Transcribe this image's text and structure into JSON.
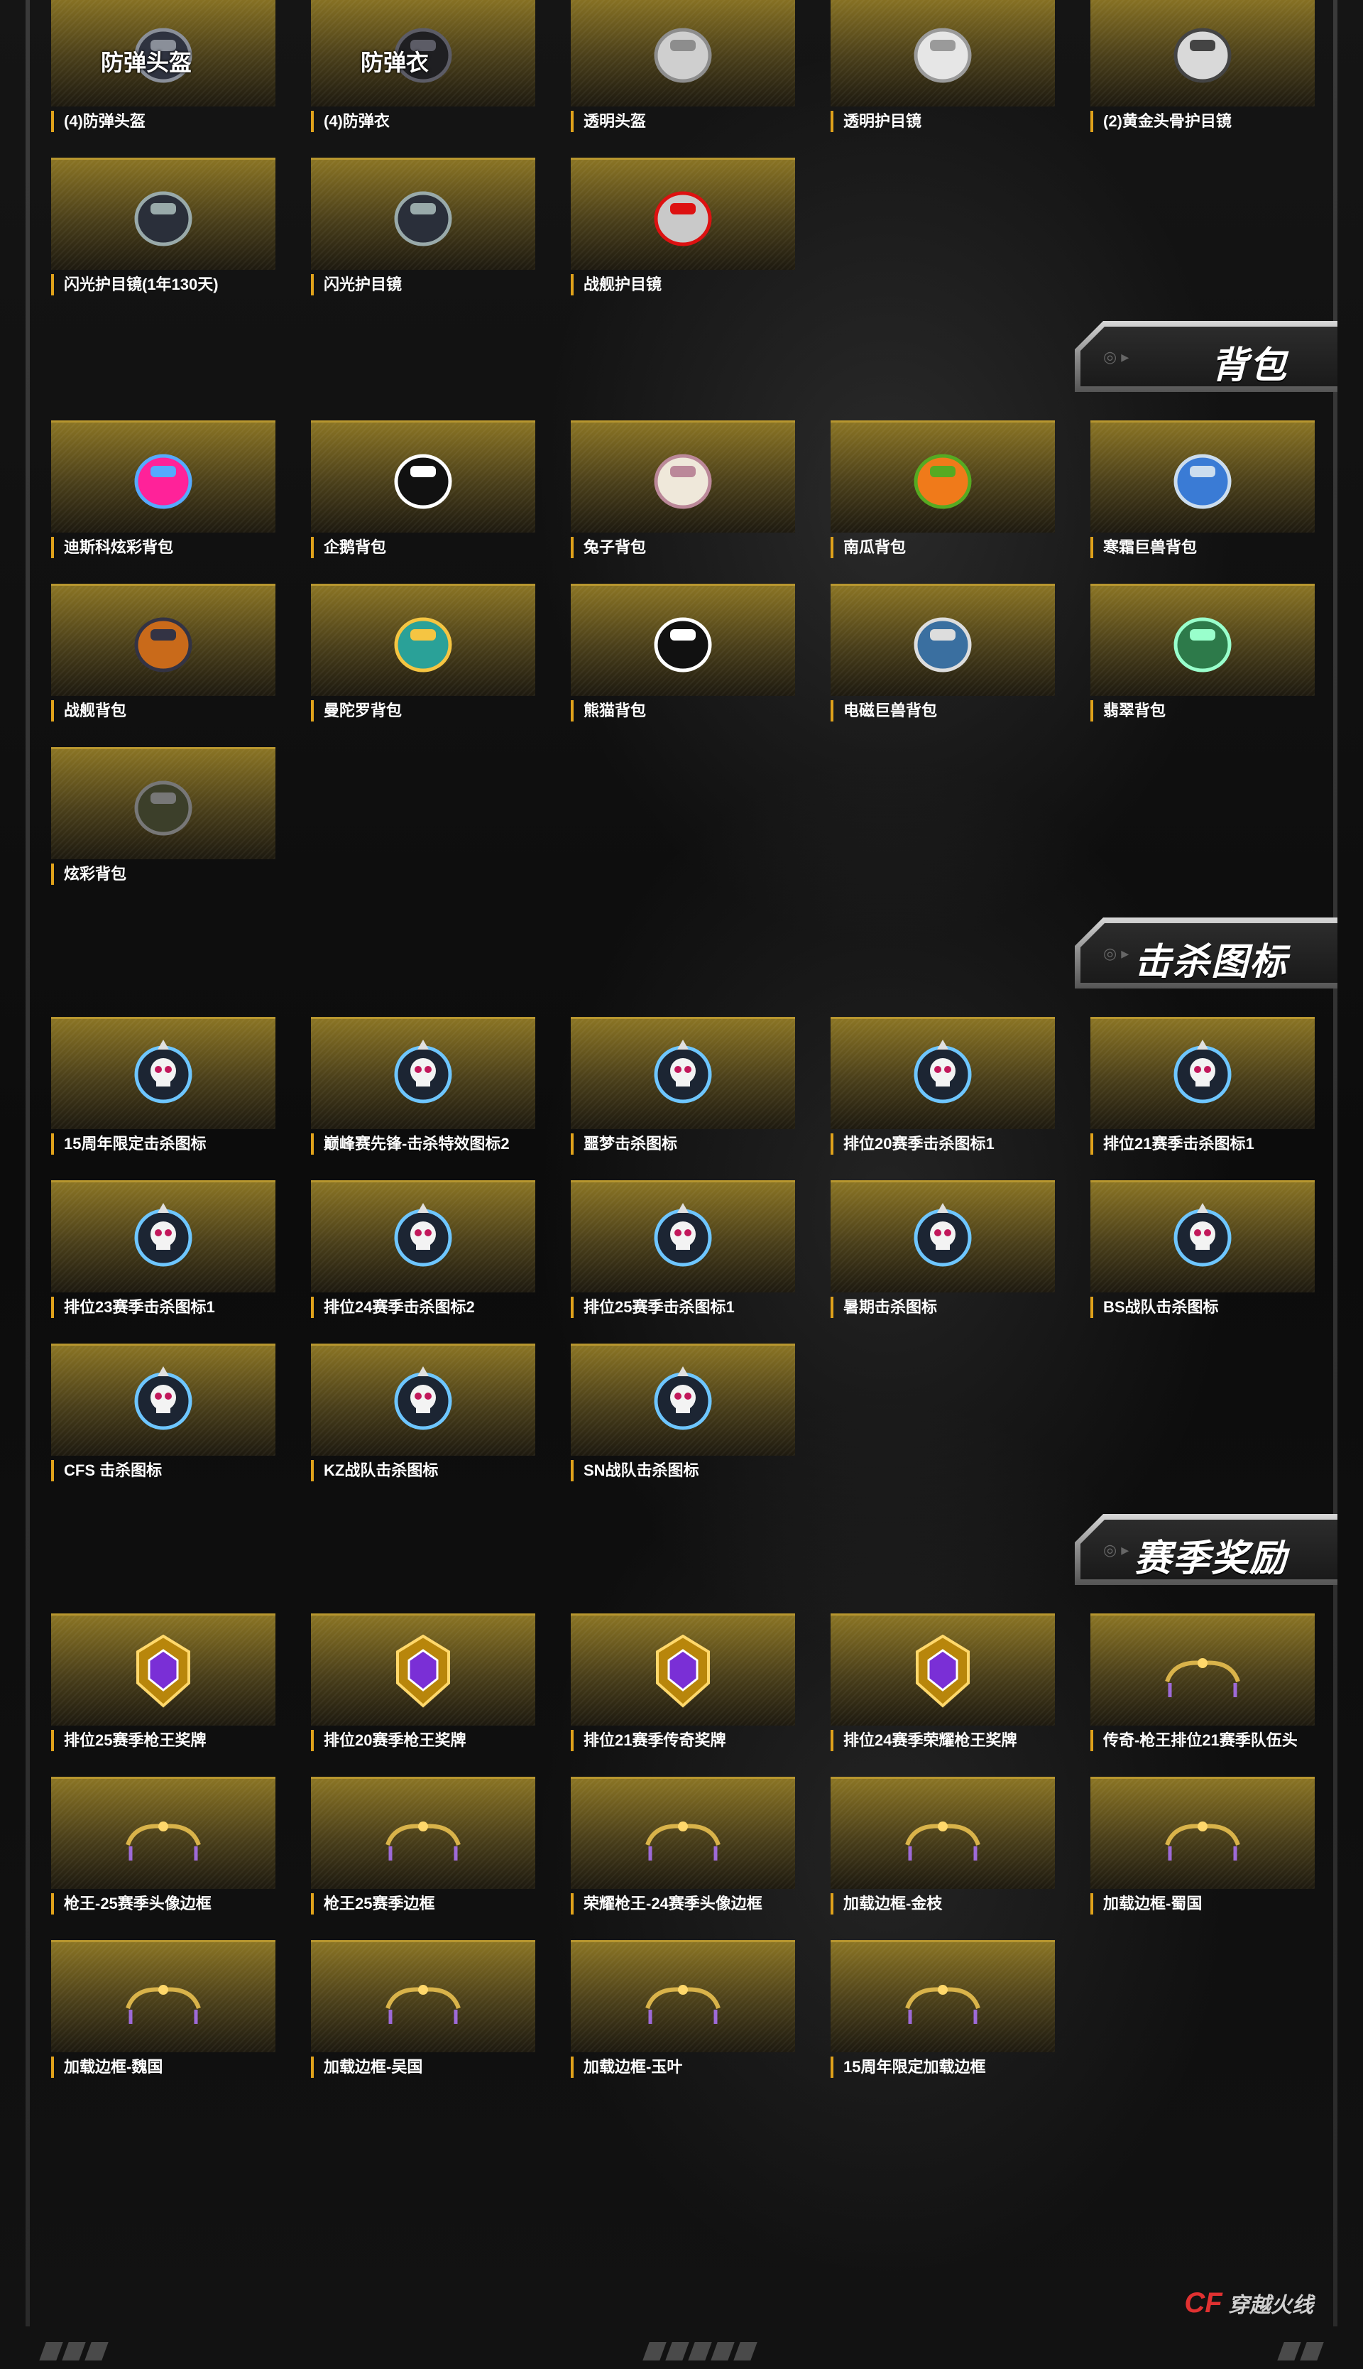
{
  "sections": [
    {
      "id": "gear",
      "title": "",
      "items": [
        {
          "label": "(4)防弹头盔",
          "icon": "helmet-icon",
          "caption": "防弹头盔"
        },
        {
          "label": "(4)防弹衣",
          "icon": "vest-icon",
          "caption": "防弹衣"
        },
        {
          "label": "透明头盔",
          "icon": "clear-helmet-icon",
          "caption": ""
        },
        {
          "label": "透明护目镜",
          "icon": "goggles-icon",
          "caption": ""
        },
        {
          "label": "(2)黄金头骨护目镜",
          "icon": "skull-goggles-icon",
          "caption": ""
        },
        {
          "label": "闪光护目镜(1年130天)",
          "icon": "sunglasses-icon",
          "caption": ""
        },
        {
          "label": "闪光护目镜",
          "icon": "sunglasses-icon",
          "caption": ""
        },
        {
          "label": "战舰护目镜",
          "icon": "battleship-goggles-icon",
          "caption": ""
        }
      ]
    },
    {
      "id": "backpack",
      "title": "背包",
      "items": [
        {
          "label": "迪斯科炫彩背包",
          "icon": "disco-backpack-icon"
        },
        {
          "label": "企鹅背包",
          "icon": "penguin-backpack-icon"
        },
        {
          "label": "兔子背包",
          "icon": "rabbit-backpack-icon"
        },
        {
          "label": "南瓜背包",
          "icon": "pumpkin-backpack-icon"
        },
        {
          "label": "寒霜巨兽背包",
          "icon": "frost-beast-backpack-icon"
        },
        {
          "label": "战舰背包",
          "icon": "battleship-backpack-icon"
        },
        {
          "label": "曼陀罗背包",
          "icon": "mandala-backpack-icon"
        },
        {
          "label": "熊猫背包",
          "icon": "panda-backpack-icon"
        },
        {
          "label": "电磁巨兽背包",
          "icon": "em-beast-backpack-icon"
        },
        {
          "label": "翡翠背包",
          "icon": "jade-backpack-icon"
        },
        {
          "label": "炫彩背包",
          "icon": "colorful-backpack-icon"
        }
      ]
    },
    {
      "id": "kill-icon",
      "title": "击杀图标",
      "items": [
        {
          "label": "15周年限定击杀图标",
          "icon": "anniversary-kill-icon"
        },
        {
          "label": "巅峰赛先锋-击杀特效图标2",
          "icon": "peak-vanguard-kill-icon"
        },
        {
          "label": "噩梦击杀图标",
          "icon": "nightmare-kill-icon"
        },
        {
          "label": "排位20赛季击杀图标1",
          "icon": "ranked-s20-kill-icon"
        },
        {
          "label": "排位21赛季击杀图标1",
          "icon": "ranked-s21-kill-icon"
        },
        {
          "label": "排位23赛季击杀图标1",
          "icon": "ranked-s23-kill-icon"
        },
        {
          "label": "排位24赛季击杀图标2",
          "icon": "ranked-s24-kill-icon"
        },
        {
          "label": "排位25赛季击杀图标1",
          "icon": "ranked-s25-kill-icon"
        },
        {
          "label": "暑期击杀图标",
          "icon": "summer-kill-icon"
        },
        {
          "label": "BS战队击杀图标",
          "icon": "bs-team-kill-icon"
        },
        {
          "label": "CFS 击杀图标",
          "icon": "cfs-kill-icon"
        },
        {
          "label": "KZ战队击杀图标",
          "icon": "kz-team-kill-icon"
        },
        {
          "label": "SN战队击杀图标",
          "icon": "sn-team-kill-icon"
        }
      ]
    },
    {
      "id": "season-rewards",
      "title": "赛季奖励",
      "items": [
        {
          "label": "排位25赛季枪王奖牌",
          "icon": "s25-medal-icon"
        },
        {
          "label": "排位20赛季枪王奖牌",
          "icon": "s20-medal-icon"
        },
        {
          "label": "排位21赛季传奇奖牌",
          "icon": "s21-legend-medal-icon"
        },
        {
          "label": "排位24赛季荣耀枪王奖牌",
          "icon": "s24-glory-medal-icon"
        },
        {
          "label": "传奇-枪王排位21赛季队伍头",
          "icon": "legend-team-frame-icon"
        },
        {
          "label": "枪王-25赛季头像边框",
          "icon": "s25-avatar-frame-icon"
        },
        {
          "label": "枪王25赛季边框",
          "icon": "s25-frame-icon"
        },
        {
          "label": "荣耀枪王-24赛季头像边框",
          "icon": "s24-avatar-frame-icon"
        },
        {
          "label": "加载边框-金枝",
          "icon": "golden-branch-frame-icon"
        },
        {
          "label": "加载边框-蜀国",
          "icon": "shu-frame-icon"
        },
        {
          "label": "加载边框-魏国",
          "icon": "wei-frame-icon"
        },
        {
          "label": "加载边框-吴国",
          "icon": "wu-frame-icon"
        },
        {
          "label": "加载边框-玉叶",
          "icon": "jade-leaf-frame-icon"
        },
        {
          "label": "15周年限定加载边框",
          "icon": "anniversary-frame-icon"
        }
      ]
    }
  ],
  "footer": {
    "logo_mark": "CF",
    "logo_text": "穿越火线"
  },
  "colors": {
    "accent": "#e0a21b",
    "tile_top": "#8a7424",
    "tile_border": "#b7962f"
  }
}
